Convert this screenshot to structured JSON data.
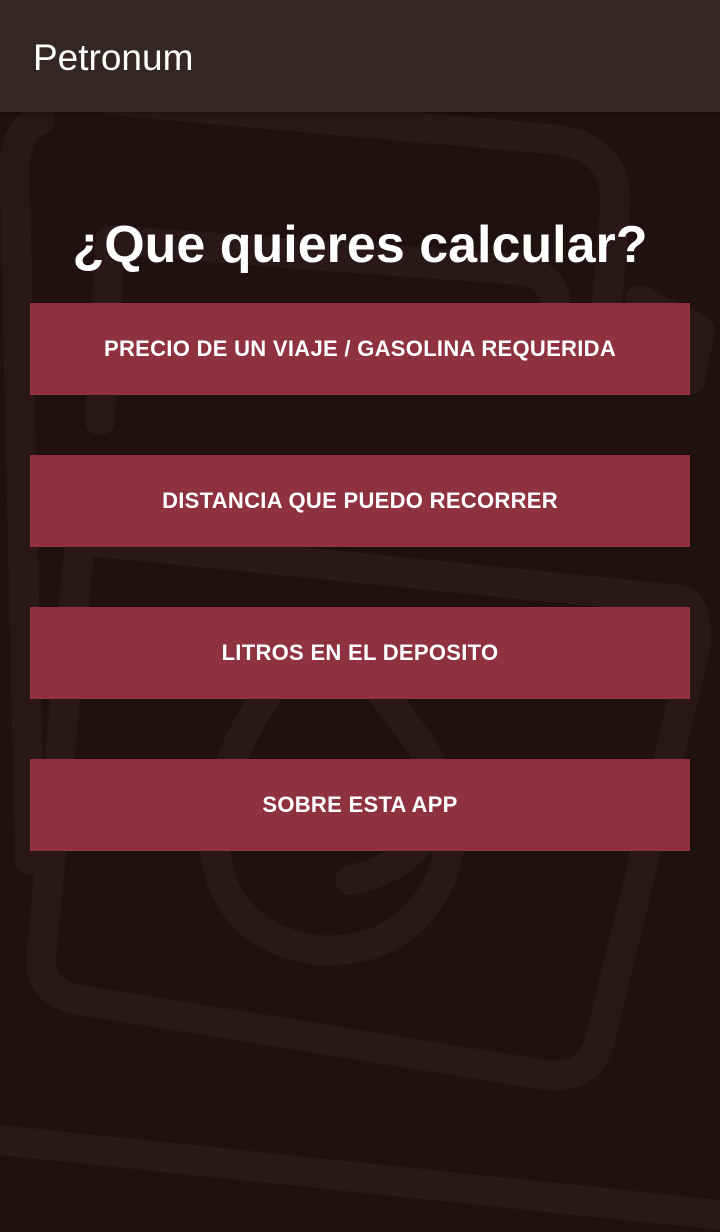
{
  "app_bar": {
    "title": "Petronum"
  },
  "main": {
    "heading": "¿Que quieres calcular?",
    "buttons": [
      {
        "label": "PRECIO DE UN VIAJE / GASOLINA REQUERIDA"
      },
      {
        "label": "DISTANCIA QUE PUEDO RECORRER"
      },
      {
        "label": "LITROS EN EL DEPOSITO"
      },
      {
        "label": "SOBRE ESTA APP"
      }
    ]
  },
  "background": {
    "icon": "fuel-pump-icon"
  },
  "colors": {
    "background": "#211010",
    "app_bar": "#352626",
    "button": "#8f3240",
    "text": "#ffffff",
    "watermark": "#2a1717"
  }
}
